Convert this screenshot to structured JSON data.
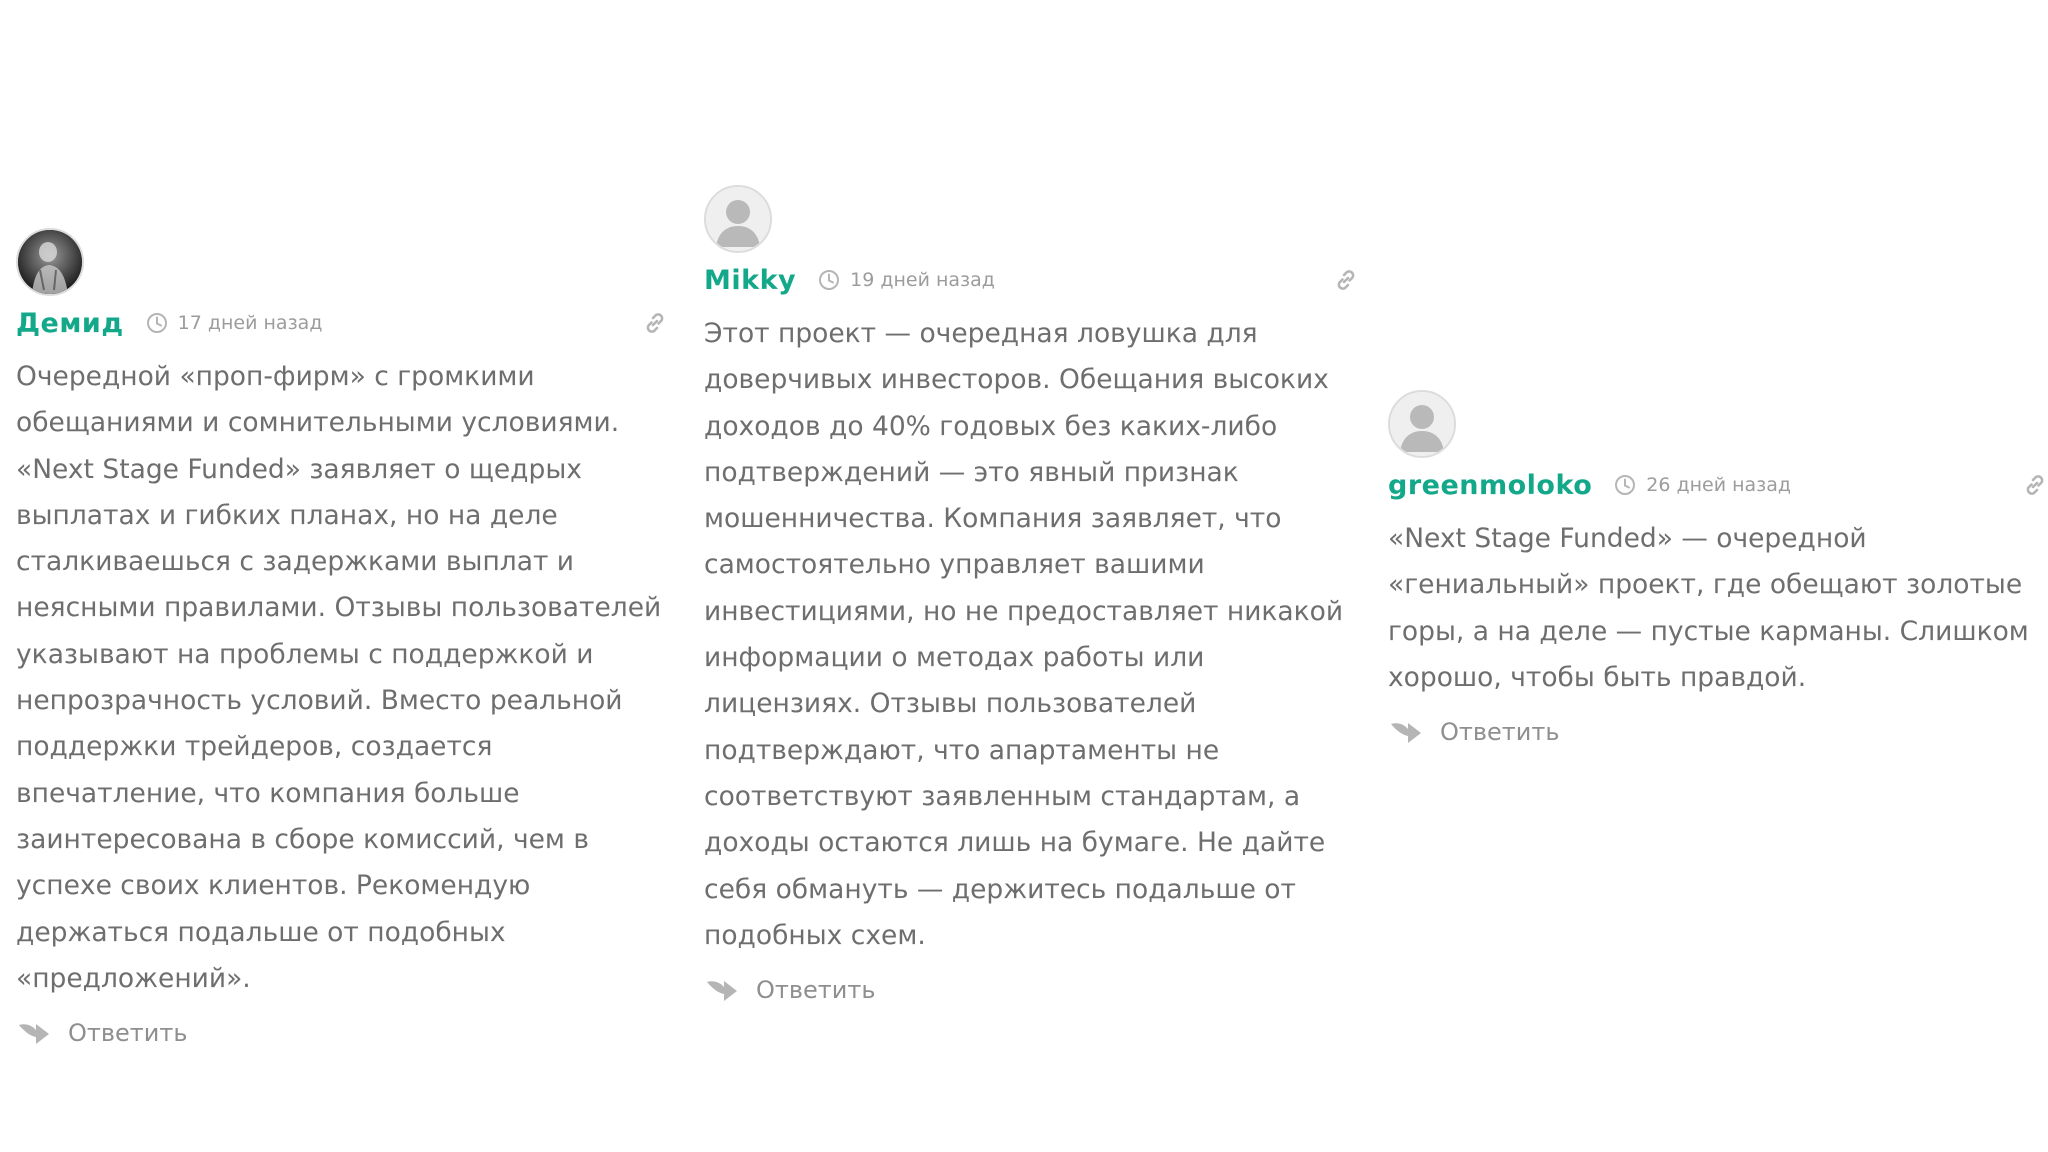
{
  "comments": [
    {
      "author": "Демид",
      "date": "17 дней назад",
      "avatar_icon": "user-photo-avatar",
      "text": "Очередной «проп-фирм» с громкими обещаниями и сомнительными условиями. «Next Stage Funded» заявляет о щедрых выплатах и гибких планах, но на деле сталкиваешься с задержками выплат и неясными правилами. Отзывы пользователей указывают на проблемы с поддержкой и непрозрачность условий. Вместо реальной поддержки трейдеров, создается впечатление, что компания больше заинтересована в сборе комиссий, чем в успехе своих клиентов. Рекомендую держаться подальше от подобных «предложений».",
      "reply_label": "Ответить"
    },
    {
      "author": "Mikky",
      "date": "19 дней назад",
      "avatar_icon": "default-user-avatar",
      "text": "Этот проект — очередная ловушка для доверчивых инвесторов. Обещания высоких доходов до 40% годовых без каких-либо подтверждений — это явный признак мошенничества. Компания заявляет, что самостоятельно управляет вашими инвестициями, но не предоставляет никакой информации о методах работы или лицензиях. Отзывы пользователей подтверждают, что апартаменты не соответствуют заявленным стандартам, а доходы остаются лишь на бумаге. Не дайте себя обмануть — держитесь подальше от подобных схем.",
      "reply_label": "Ответить"
    },
    {
      "author": "greenmoloko",
      "date": "26 дней назад",
      "avatar_icon": "default-user-avatar",
      "text": "«Next Stage Funded» — очередной «гениальный» проект, где обещают золотые горы, а на деле — пустые карманы. Слишком хорошо, чтобы быть правдой.",
      "reply_label": "Ответить"
    }
  ],
  "colors": {
    "author": "#13a88a",
    "text": "#6e6e6e",
    "meta": "#9c9c9c",
    "icon": "#b5b5b5"
  },
  "icons": {
    "time": "clock-icon",
    "permalink": "link-icon",
    "reply": "reply-arrow-icon"
  }
}
